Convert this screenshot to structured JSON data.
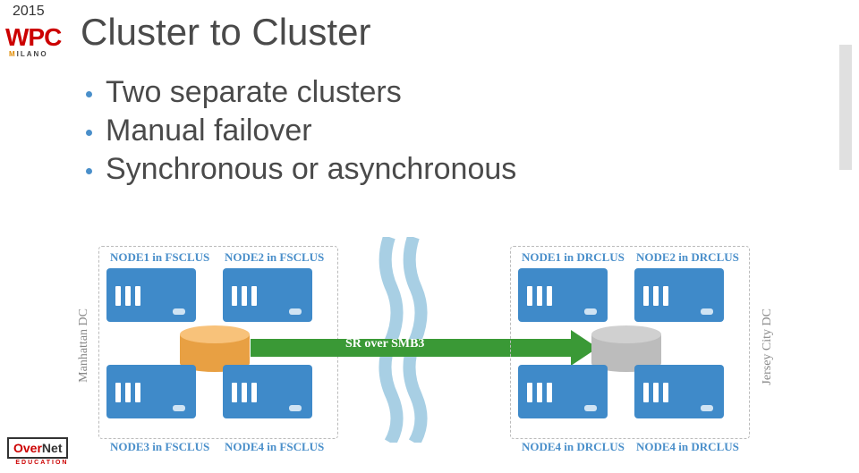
{
  "header": {
    "year": "2015",
    "logo_text": "WPC",
    "logo_sub": "ILANO",
    "logo_sub_m": "M"
  },
  "title": "Cluster to Cluster",
  "bullets": [
    "Two separate clusters",
    "Manual failover",
    "Synchronous or asynchronous"
  ],
  "diagram": {
    "left_dc_label": "Manhattan DC",
    "right_dc_label": "Jersey City DC",
    "sr_label": "SR over SMB3",
    "left_cluster": {
      "top_a": "NODE1 in FSCLUS",
      "top_b": "NODE2 in FSCLUS",
      "bot_a": "NODE3 in FSCLUS",
      "bot_b": "NODE4 in FSCLUS"
    },
    "right_cluster": {
      "top_a": "NODE1 in DRCLUS",
      "top_b": "NODE2 in DRCLUS",
      "bot_a": "NODE4 in DRCLUS",
      "bot_b": "NODE4 in DRCLUS"
    }
  },
  "footer": {
    "brand_a": "Over",
    "brand_b": "Net",
    "brand_sub": "EDUCATION"
  }
}
